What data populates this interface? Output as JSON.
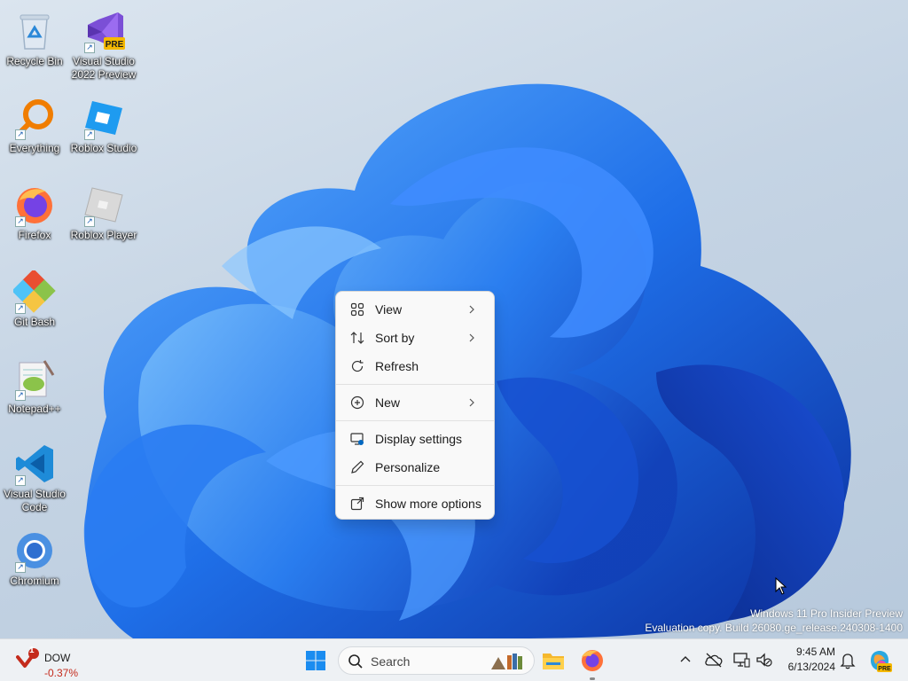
{
  "desktop": {
    "icons": [
      {
        "label": "Recycle Bin",
        "icon": "recycle-bin-icon"
      },
      {
        "label": "Visual Studio 2022 Preview",
        "icon": "visual-studio-preview-icon",
        "badge": "PRE"
      },
      {
        "label": "Everything",
        "icon": "everything-search-icon"
      },
      {
        "label": "Roblox Studio",
        "icon": "roblox-studio-icon"
      },
      {
        "label": "Firefox",
        "icon": "firefox-icon"
      },
      {
        "label": "Roblox Player",
        "icon": "roblox-player-icon"
      },
      {
        "label": "Git Bash",
        "icon": "git-bash-icon"
      },
      {
        "label": "Notepad++",
        "icon": "notepad-plus-plus-icon"
      },
      {
        "label": "Visual Studio Code",
        "icon": "vscode-icon"
      },
      {
        "label": "Chromium",
        "icon": "chromium-icon"
      }
    ],
    "shortcut_glyph": "↗"
  },
  "context_menu": {
    "items": [
      {
        "label": "View",
        "icon": "grid-view-icon",
        "submenu": true
      },
      {
        "label": "Sort by",
        "icon": "sort-icon",
        "submenu": true
      },
      {
        "label": "Refresh",
        "icon": "refresh-icon",
        "submenu": false
      },
      {
        "label": "New",
        "icon": "new-plus-icon",
        "submenu": true
      },
      {
        "label": "Display settings",
        "icon": "display-settings-icon",
        "submenu": false
      },
      {
        "label": "Personalize",
        "icon": "pen-icon",
        "submenu": false
      },
      {
        "label": "Show more options",
        "icon": "share-more-icon",
        "submenu": false
      }
    ]
  },
  "watermark": {
    "line1": "Windows 11 Pro Insider Preview",
    "line2": "Evaluation copy. Build 26080.ge_release.240308-1400"
  },
  "taskbar": {
    "widget": {
      "name": "DOW",
      "change": "-0.37%",
      "alert_count": "1"
    },
    "search_placeholder": "Search",
    "apps": [
      "start-button",
      "search",
      "file-explorer",
      "firefox"
    ],
    "tray": {
      "time": "9:45 AM",
      "date": "6/13/2024",
      "copilot_badge": "PRE"
    }
  },
  "colors": {
    "accent": "#0067c0",
    "wallpaper_blue": "#1b5fe0",
    "negative": "#c42b1c"
  }
}
